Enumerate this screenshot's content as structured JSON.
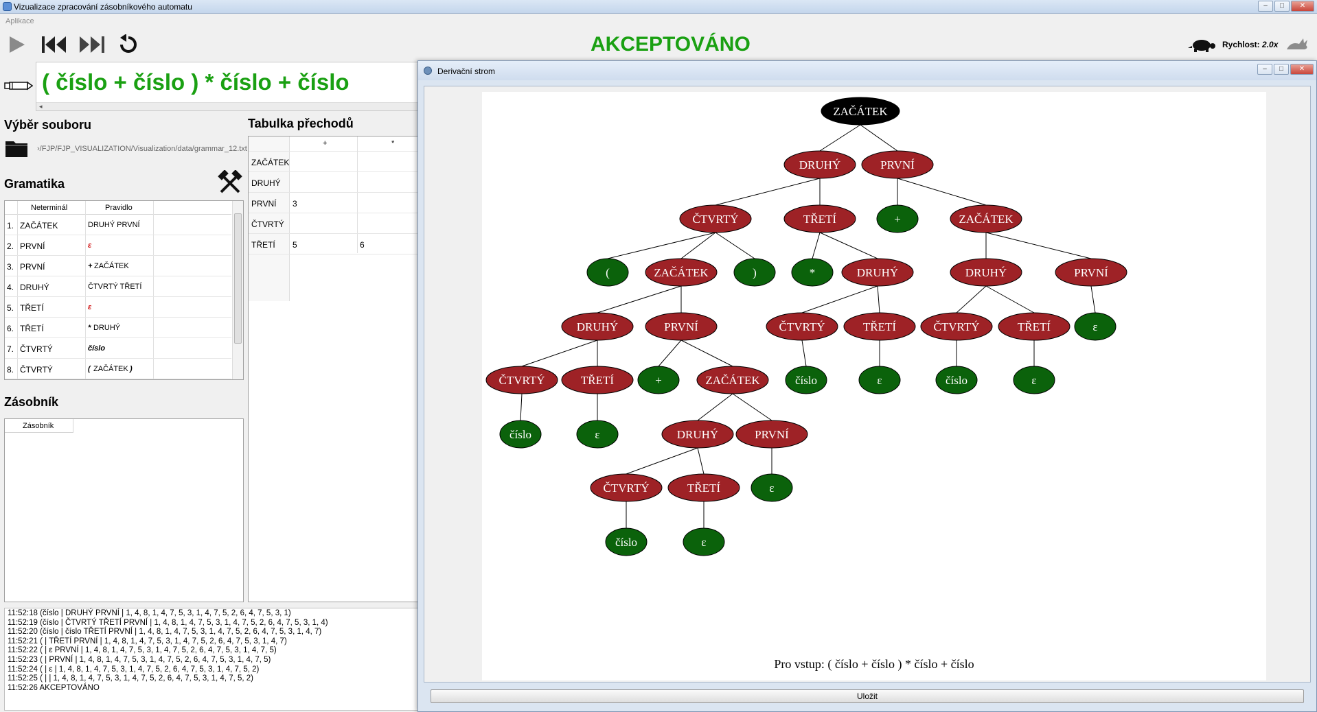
{
  "window": {
    "title": "Vizualizace zpracování zásobníkového automatu",
    "min": "–",
    "max": "□",
    "close": "✕"
  },
  "menu": {
    "app": "Aplikace"
  },
  "status": "AKCEPTOVÁNO",
  "speed": {
    "label": "Rychlost:",
    "value": "2.0x"
  },
  "input": {
    "text": "( číslo + číslo ) * číslo + číslo",
    "scroll_arrow": "◂"
  },
  "file": {
    "title": "Výběr souboru",
    "path": "›/FJP/FJP_VISUALIZATION/Visualization/data/grammar_12.txt"
  },
  "grammar": {
    "title": "Gramatika",
    "col_nonterminal": "Neterminál",
    "col_rule": "Pravidlo",
    "rows": [
      {
        "n": "1.",
        "nt": "ZAČÁTEK",
        "rule": "DRUHÝ PRVNÍ"
      },
      {
        "n": "2.",
        "nt": "PRVNÍ",
        "rule": "ε"
      },
      {
        "n": "3.",
        "nt": "PRVNÍ",
        "rule_sym": "+",
        "rule": "ZAČÁTEK"
      },
      {
        "n": "4.",
        "nt": "DRUHÝ",
        "rule": "ČTVRTÝ TŘETÍ"
      },
      {
        "n": "5.",
        "nt": "TŘETÍ",
        "rule": "ε"
      },
      {
        "n": "6.",
        "nt": "TŘETÍ",
        "rule_sym": "*",
        "rule": "DRUHÝ"
      },
      {
        "n": "7.",
        "nt": "ČTVRTÝ",
        "rule": "číslo"
      },
      {
        "n": "8.",
        "nt": "ČTVRTÝ",
        "rule_sym": "(",
        "rule": "ZAČÁTEK",
        "rule_end": ")"
      }
    ]
  },
  "stack": {
    "title": "Zásobník",
    "col": "Zásobník"
  },
  "transitions": {
    "title": "Tabulka přechodů",
    "cols": [
      "+",
      "*"
    ],
    "rows": [
      {
        "nt": "ZAČÁTEK",
        "plus": "",
        "star": ""
      },
      {
        "nt": "DRUHÝ",
        "plus": "",
        "star": ""
      },
      {
        "nt": "PRVNÍ",
        "plus": "3",
        "star": ""
      },
      {
        "nt": "ČTVRTÝ",
        "plus": "",
        "star": ""
      },
      {
        "nt": "TŘETÍ",
        "plus": "5",
        "star": "6"
      }
    ]
  },
  "log": [
    "11:52:18 (číslo | DRUHÝ PRVNÍ | 1, 4, 8, 1, 4, 7, 5, 3, 1, 4, 7, 5, 2, 6, 4, 7, 5, 3, 1)",
    "11:52:19 (číslo | ČTVRTÝ TŘETÍ PRVNÍ | 1, 4, 8, 1, 4, 7, 5, 3, 1, 4, 7, 5, 2, 6, 4, 7, 5, 3, 1, 4)",
    "11:52:20 (číslo | číslo TŘETÍ PRVNÍ | 1, 4, 8, 1, 4, 7, 5, 3, 1, 4, 7, 5, 2, 6, 4, 7, 5, 3, 1, 4, 7)",
    "11:52:21 ( | TŘETÍ PRVNÍ | 1, 4, 8, 1, 4, 7, 5, 3, 1, 4, 7, 5, 2, 6, 4, 7, 5, 3, 1, 4, 7)",
    "11:52:22 ( | ε PRVNÍ | 1, 4, 8, 1, 4, 7, 5, 3, 1, 4, 7, 5, 2, 6, 4, 7, 5, 3, 1, 4, 7, 5)",
    "11:52:23 ( | PRVNÍ | 1, 4, 8, 1, 4, 7, 5, 3, 1, 4, 7, 5, 2, 6, 4, 7, 5, 3, 1, 4, 7, 5)",
    "11:52:24 ( | ε | 1, 4, 8, 1, 4, 7, 5, 3, 1, 4, 7, 5, 2, 6, 4, 7, 5, 3, 1, 4, 7, 5, 2)",
    "11:52:25 ( | | 1, 4, 8, 1, 4, 7, 5, 3, 1, 4, 7, 5, 2, 6, 4, 7, 5, 3, 1, 4, 7, 5, 2)",
    "11:52:26 AKCEPTOVÁNO"
  ],
  "tree_window": {
    "title": "Derivační strom",
    "save": "Uložit",
    "caption": "Pro vstup: ( číslo + číslo ) * číslo + číslo"
  },
  "tree_nodes": [
    {
      "id": "n0",
      "label": "ZAČÁTEK",
      "kind": "root"
    },
    {
      "id": "n1",
      "label": "DRUHÝ",
      "kind": "nt",
      "p": "n0"
    },
    {
      "id": "n2",
      "label": "PRVNÍ",
      "kind": "nt",
      "p": "n0"
    },
    {
      "id": "n3",
      "label": "ČTVRTÝ",
      "kind": "nt",
      "p": "n1"
    },
    {
      "id": "n4",
      "label": "TŘETÍ",
      "kind": "nt",
      "p": "n1"
    },
    {
      "id": "n5",
      "label": "+",
      "kind": "t",
      "p": "n2"
    },
    {
      "id": "n6",
      "label": "ZAČÁTEK",
      "kind": "nt",
      "p": "n2"
    },
    {
      "id": "n7",
      "label": "(",
      "kind": "t",
      "p": "n3"
    },
    {
      "id": "n8",
      "label": "ZAČÁTEK",
      "kind": "nt",
      "p": "n3"
    },
    {
      "id": "n9",
      "label": ")",
      "kind": "t",
      "p": "n3"
    },
    {
      "id": "n10",
      "label": "*",
      "kind": "t",
      "p": "n4"
    },
    {
      "id": "n11",
      "label": "DRUHÝ",
      "kind": "nt",
      "p": "n4"
    },
    {
      "id": "n12",
      "label": "DRUHÝ",
      "kind": "nt",
      "p": "n6"
    },
    {
      "id": "n13",
      "label": "PRVNÍ",
      "kind": "nt",
      "p": "n6"
    },
    {
      "id": "n14",
      "label": "DRUHÝ",
      "kind": "nt",
      "p": "n8"
    },
    {
      "id": "n15",
      "label": "PRVNÍ",
      "kind": "nt",
      "p": "n8"
    },
    {
      "id": "n16",
      "label": "ČTVRTÝ",
      "kind": "nt",
      "p": "n11"
    },
    {
      "id": "n17",
      "label": "TŘETÍ",
      "kind": "nt",
      "p": "n11"
    },
    {
      "id": "n18",
      "label": "ČTVRTÝ",
      "kind": "nt",
      "p": "n12"
    },
    {
      "id": "n19",
      "label": "TŘETÍ",
      "kind": "nt",
      "p": "n12"
    },
    {
      "id": "n20",
      "label": "ε",
      "kind": "t",
      "p": "n13"
    },
    {
      "id": "n21",
      "label": "ČTVRTÝ",
      "kind": "nt",
      "p": "n14"
    },
    {
      "id": "n22",
      "label": "TŘETÍ",
      "kind": "nt",
      "p": "n14"
    },
    {
      "id": "n23",
      "label": "+",
      "kind": "t",
      "p": "n15"
    },
    {
      "id": "n24",
      "label": "ZAČÁTEK",
      "kind": "nt",
      "p": "n15"
    },
    {
      "id": "n25",
      "label": "číslo",
      "kind": "t",
      "p": "n16"
    },
    {
      "id": "n26",
      "label": "ε",
      "kind": "t",
      "p": "n17"
    },
    {
      "id": "n27",
      "label": "číslo",
      "kind": "t",
      "p": "n18"
    },
    {
      "id": "n28",
      "label": "ε",
      "kind": "t",
      "p": "n19"
    },
    {
      "id": "n29",
      "label": "číslo",
      "kind": "t",
      "p": "n21"
    },
    {
      "id": "n30",
      "label": "ε",
      "kind": "t",
      "p": "n22"
    },
    {
      "id": "n31",
      "label": "DRUHÝ",
      "kind": "nt",
      "p": "n24"
    },
    {
      "id": "n32",
      "label": "PRVNÍ",
      "kind": "nt",
      "p": "n24"
    },
    {
      "id": "n33",
      "label": "ČTVRTÝ",
      "kind": "nt",
      "p": "n31"
    },
    {
      "id": "n34",
      "label": "TŘETÍ",
      "kind": "nt",
      "p": "n31"
    },
    {
      "id": "n35",
      "label": "ε",
      "kind": "t",
      "p": "n32"
    },
    {
      "id": "n36",
      "label": "číslo",
      "kind": "t",
      "p": "n33"
    },
    {
      "id": "n37",
      "label": "ε",
      "kind": "t",
      "p": "n34"
    }
  ],
  "colors": {
    "accept": "#1aa012",
    "nonterminal": "#9e2226",
    "terminal": "#0b620b",
    "root": "#000000"
  }
}
